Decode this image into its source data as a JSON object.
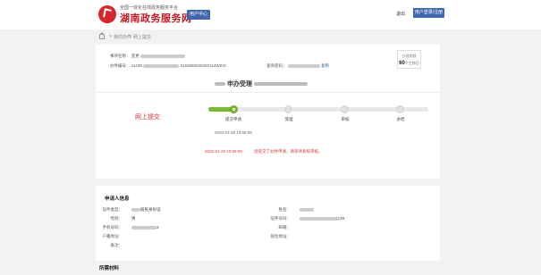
{
  "header": {
    "logo_small": "全国一体化在线政务服务平台",
    "logo_big": "湖南政务服务网",
    "user_center": "用户中心",
    "user_name": "退出",
    "top_button": "用户登录/注册"
  },
  "breadcrumb": {
    "home": "",
    "sep1": ">",
    "item1": "我的办件",
    "sep2": ">",
    "item2": "网上提交"
  },
  "case_info": {
    "name_label": "事项名称：",
    "name_value": "变更",
    "number_label": "办件编号：",
    "number_prefix": "11430",
    "number_suffix": "0153080020200124W031",
    "query_label": "查询密码：",
    "copy": "复制",
    "timer_label": "办理期限",
    "timer_value": "60",
    "timer_unit": "个工作日"
  },
  "title": "申办受理",
  "status_label": "网上提交",
  "steps": [
    {
      "label": "提交申请",
      "active": true
    },
    {
      "label": "受理",
      "active": false
    },
    {
      "label": "审核",
      "active": false
    },
    {
      "label": "办结",
      "active": false
    }
  ],
  "step_time": "2020-01-28 10:56:09",
  "hint_time": "2020-01-28 10:56:09",
  "hint_text": "您提交了办件申请，请等待系统审核。",
  "applicant": {
    "title": "申请人信息",
    "doc_type_label": "证件类型：",
    "doc_type_value": "居民身份证",
    "sex_label": "性别：",
    "sex_value": "男",
    "phone_label": "手机号码：",
    "phone_value": "3",
    "addr_label": "户籍地址：",
    "note_label": "备注：",
    "name_label": "姓名：",
    "id_label": "证件号码：",
    "id_value": "19",
    "email_label": "邮箱：",
    "live_label": "居住地址："
  },
  "bottom_section": "所需材料"
}
